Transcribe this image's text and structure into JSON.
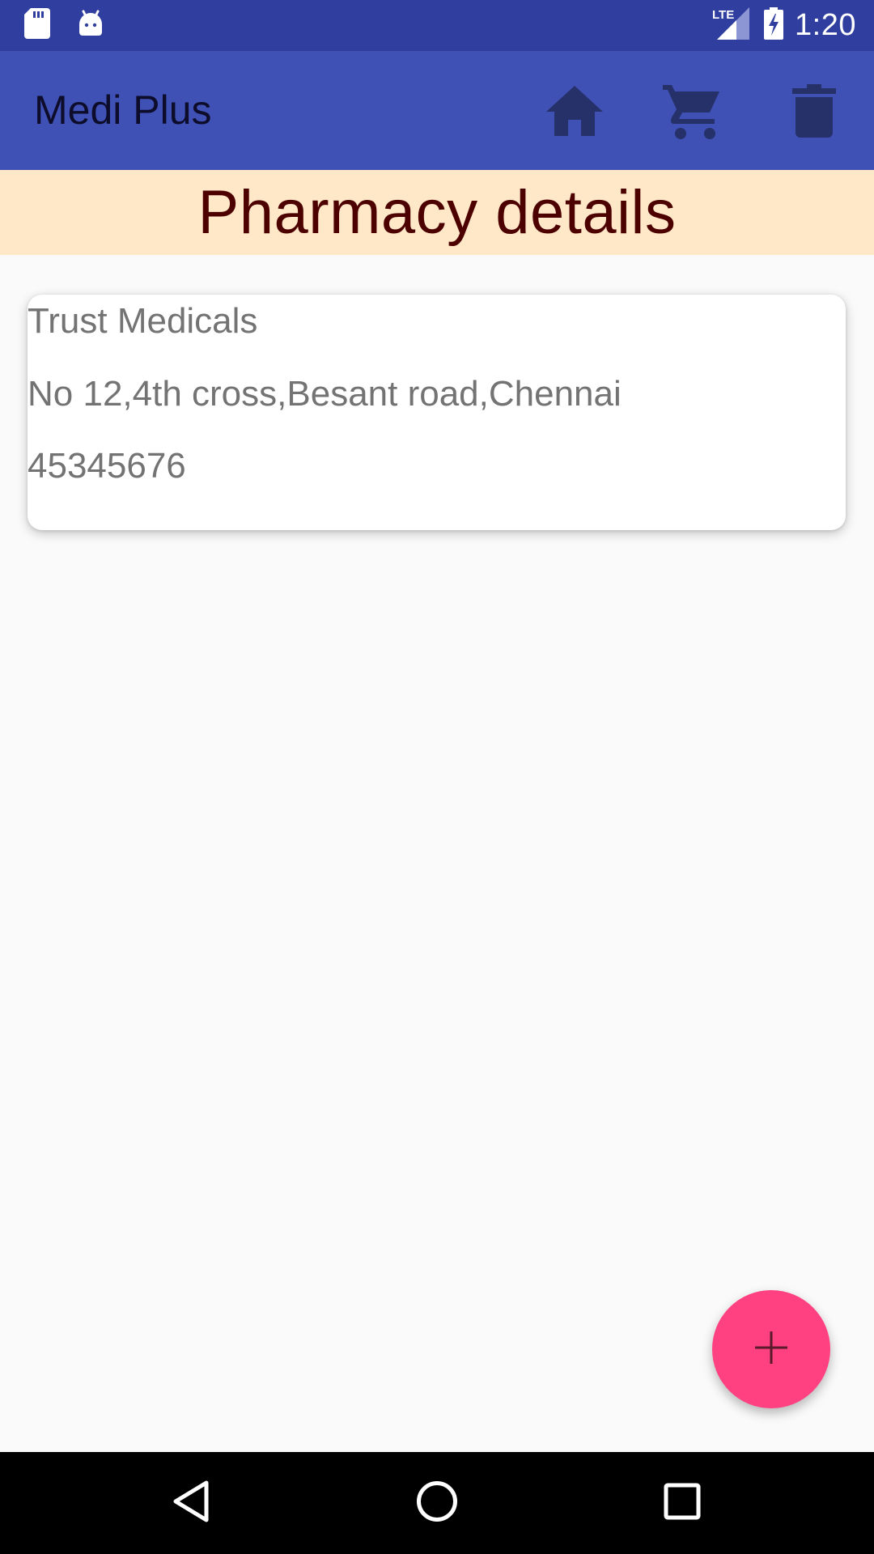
{
  "status_bar": {
    "time": "1:20",
    "network": "LTE",
    "icons": [
      "sd-card-icon",
      "android-icon",
      "signal-icon",
      "battery-charging-icon"
    ]
  },
  "app_bar": {
    "title": "Medi Plus",
    "actions": [
      "home-icon",
      "cart-icon",
      "delete-icon"
    ]
  },
  "heading": "Pharmacy details",
  "pharmacy": {
    "name": "Trust Medicals",
    "address": "No 12,4th cross,Besant road,Chennai",
    "phone": "45345676"
  },
  "fab": {
    "icon": "plus-icon"
  },
  "nav_bar": {
    "icons": [
      "back-icon",
      "home-circle-icon",
      "recents-icon"
    ]
  },
  "colors": {
    "status_bar": "#303f9f",
    "app_bar": "#3f51b5",
    "heading_band": "#ffe8c8",
    "heading_text": "#4d0000",
    "fab": "#ff4081",
    "background": "#fafafa"
  }
}
